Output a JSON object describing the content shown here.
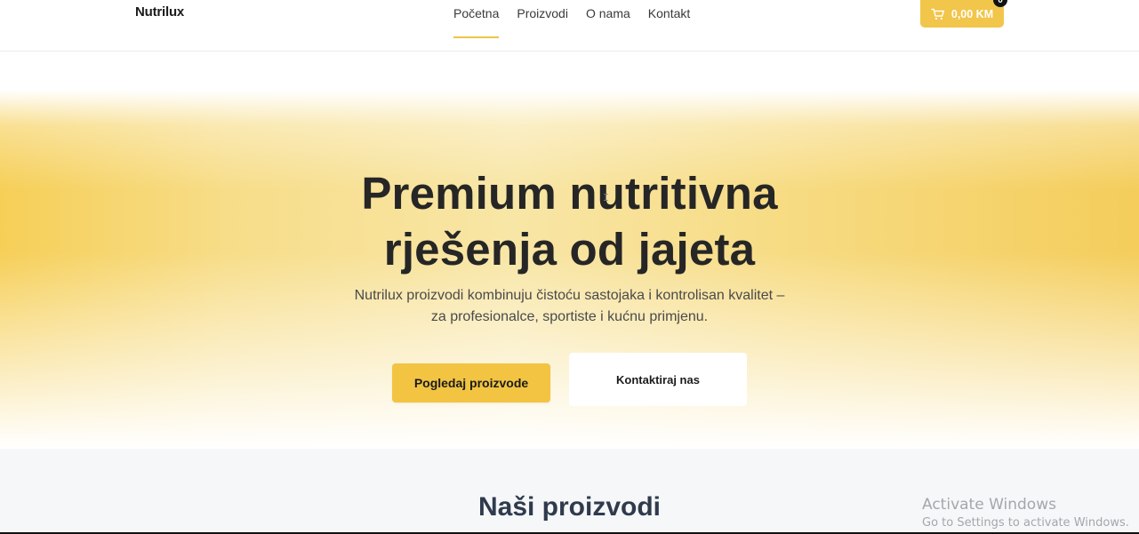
{
  "header": {
    "logo": "Nutrilux",
    "nav": [
      {
        "label": "Početna",
        "active": true
      },
      {
        "label": "Proizvodi",
        "active": false
      },
      {
        "label": "O nama",
        "active": false
      },
      {
        "label": "Kontakt",
        "active": false
      }
    ],
    "cart": {
      "total": "0,00 KM",
      "count": "0",
      "icon": "shopping-cart-icon"
    }
  },
  "hero": {
    "title_line1": "Premium nutritivna",
    "title_line2": "rješenja od jajeta",
    "subtitle_line1": "Nutrilux proizvodi kombinuju čistoću sastojaka i kontrolisan kvalitet –",
    "subtitle_line2": "za profesionalce, sportiste i kućnu primjenu.",
    "primary_button": "Pogledaj proizvode",
    "secondary_button": "Kontaktiraj nas"
  },
  "products_section": {
    "title": "Naši proizvodi"
  },
  "os_watermark": {
    "title": "Activate Windows",
    "subtitle": "Go to Settings to activate Windows."
  },
  "colors": {
    "accent": "#f2c442",
    "heading": "#262626",
    "section_heading": "#2f3b4d"
  }
}
